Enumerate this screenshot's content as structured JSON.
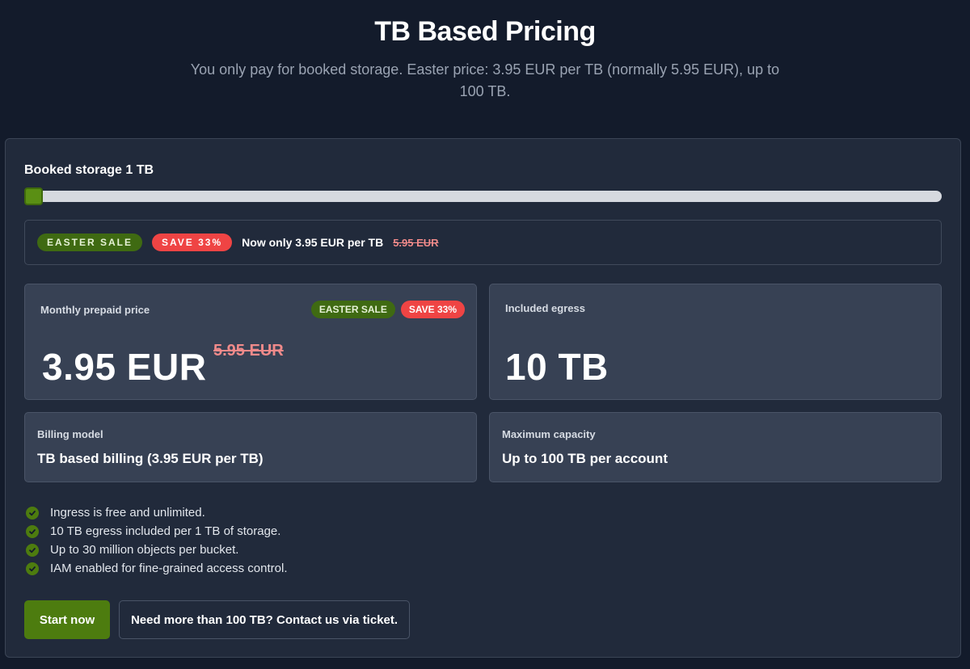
{
  "header": {
    "title": "TB Based Pricing",
    "subtitle": "You only pay for booked storage. Easter price: 3.95 EUR per TB (normally 5.95 EUR), up to 100 TB."
  },
  "storage": {
    "label": "Booked storage 1 TB",
    "slider_value_fraction": 0.01
  },
  "banner": {
    "sale_badge": "EASTER SALE",
    "save_badge": "SAVE 33%",
    "text": "Now only 3.95 EUR per TB",
    "old_price": "5.95 EUR"
  },
  "tiles": {
    "price": {
      "label": "Monthly prepaid price",
      "sale_badge": "EASTER SALE",
      "save_badge": "SAVE 33%",
      "value": "3.95 EUR",
      "old_value": "5.95 EUR"
    },
    "egress": {
      "label": "Included egress",
      "value": "10 TB"
    },
    "billing": {
      "label": "Billing model",
      "value": "TB based billing (3.95 EUR per TB)"
    },
    "capacity": {
      "label": "Maximum capacity",
      "value": "Up to 100 TB per account"
    }
  },
  "features": [
    "Ingress is free and unlimited.",
    "10 TB egress included per 1 TB of storage.",
    "Up to 30 million objects per bucket.",
    "IAM enabled for fine-grained access control."
  ],
  "actions": {
    "start_label": "Start now",
    "contact_label": "Need more than 100 TB? Contact us via ticket."
  },
  "colors": {
    "background": "#131b2b",
    "card": "#212a3b",
    "accent_green": "#4d7c0f",
    "sale_red": "#ef4444"
  }
}
